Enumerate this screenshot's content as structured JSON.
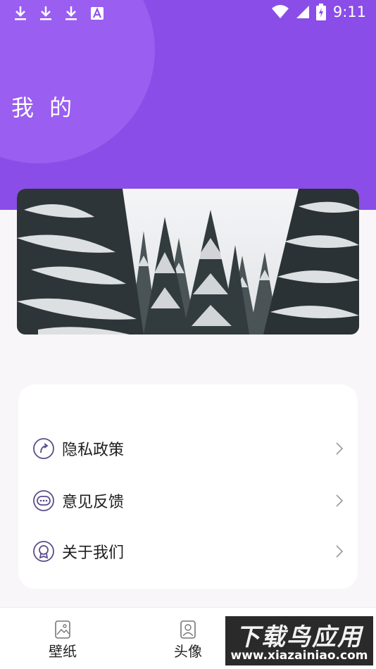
{
  "status_bar": {
    "time": "9:11",
    "left_icons": [
      "download-icon",
      "download-icon",
      "download-icon",
      "a-notification-icon"
    ],
    "right_icons": [
      "wifi-icon",
      "signal-icon",
      "battery-icon"
    ]
  },
  "header": {
    "title": "我 的",
    "background_color": "#8a4de8"
  },
  "banner": {
    "image": "snow-covered-pine-forest"
  },
  "menu": {
    "items": [
      {
        "label": "隐私政策",
        "icon": "privacy-arrow-icon"
      },
      {
        "label": "意见反馈",
        "icon": "feedback-chat-icon"
      },
      {
        "label": "关于我们",
        "icon": "about-badge-icon"
      }
    ],
    "chevron_icon": "chevron-right-icon"
  },
  "tabbar": {
    "tabs": [
      {
        "label": "壁纸",
        "icon": "wallpaper-icon"
      },
      {
        "label": "头像",
        "icon": "avatar-icon"
      }
    ]
  },
  "watermark": {
    "title": "下载鸟应用",
    "url": "www.xiazainiao.com"
  }
}
